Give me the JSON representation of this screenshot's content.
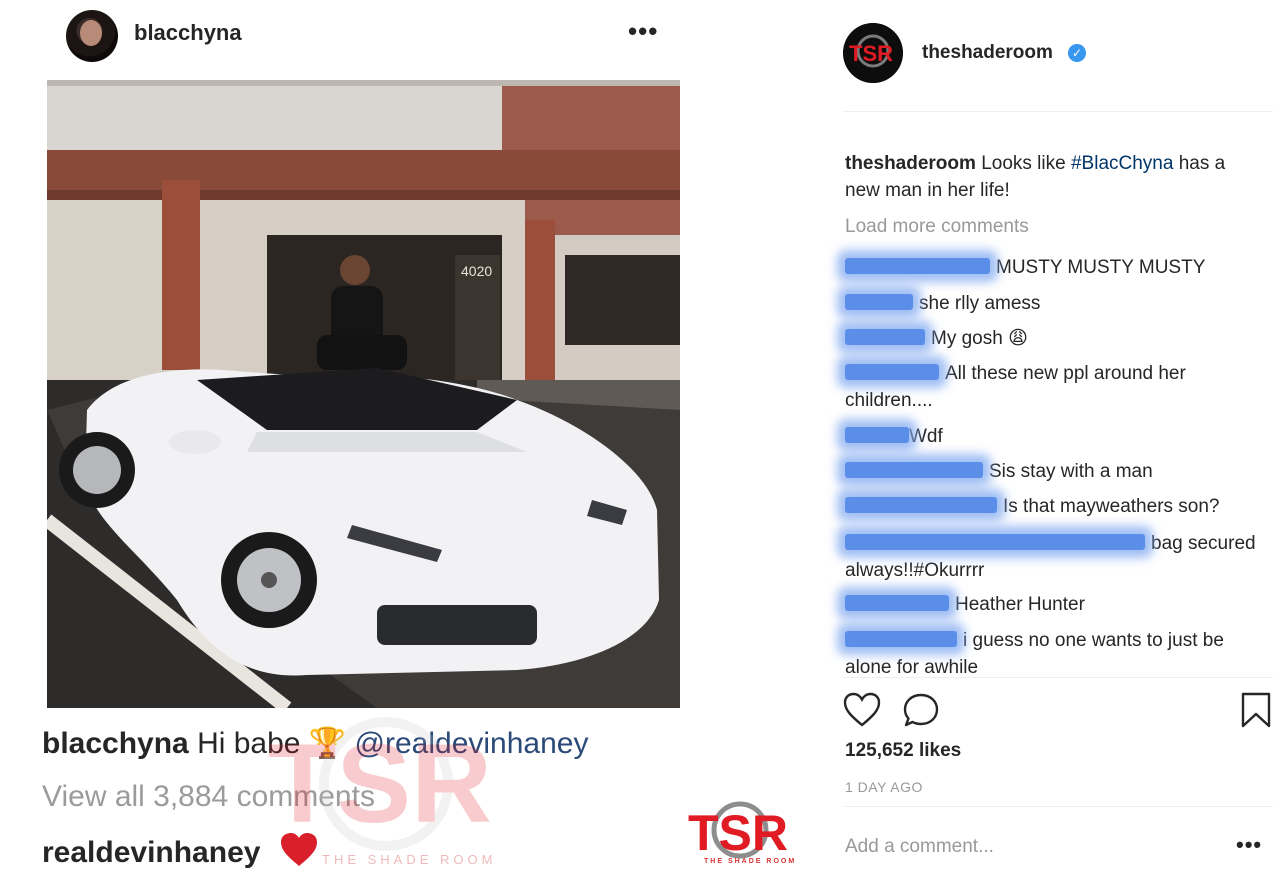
{
  "left_post": {
    "username": "blacchyna",
    "more_glyph": "•••",
    "caption_user": "blacchyna",
    "caption_text": "Hi babe",
    "caption_emoji": "🏆",
    "caption_mention": "@realdevinhaney",
    "view_all_comments": "View all 3,884 comments",
    "comment_user": "realdevinhaney",
    "comment_emoji": "heart-emoji",
    "photo": {
      "storefront_number": "4020"
    }
  },
  "watermark": {
    "logo_text": "TSR",
    "sub_text": "THE SHADE ROOM"
  },
  "corner_logo": {
    "logo_text": "TSR",
    "sub_text": "THE SHADE ROOM"
  },
  "right_post": {
    "username": "theshaderoom",
    "verified": true,
    "avatar_text": "TSR",
    "caption": {
      "user": "theshaderoom",
      "before_tag": "Looks like",
      "hashtag": "#BlacChyna",
      "after_tag": "has a new man in her life!"
    },
    "load_more": "Load more comments",
    "comments": [
      {
        "text": "MUSTY MUSTY MUSTY"
      },
      {
        "text": "she rlly amess"
      },
      {
        "text": "My gosh 😩"
      },
      {
        "text": "All these new ppl around her children...."
      },
      {
        "text": "Wdf"
      },
      {
        "text": "Sis stay with a man"
      },
      {
        "text": "Is that mayweathers son?"
      },
      {
        "text": "bag secured always!!#Okurrrr"
      },
      {
        "text": "Heather Hunter"
      },
      {
        "text": "i guess no one wants to just be alone for awhile"
      }
    ],
    "likes": "125,652 likes",
    "time_ago": "1 DAY AGO",
    "add_comment_placeholder": "Add a comment...",
    "more_glyph": "•••"
  },
  "colors": {
    "link": "#003569",
    "verified": "#3897f0",
    "muted": "#999999",
    "tsr_red": "#d83434",
    "blur": "#5a8ee8"
  }
}
